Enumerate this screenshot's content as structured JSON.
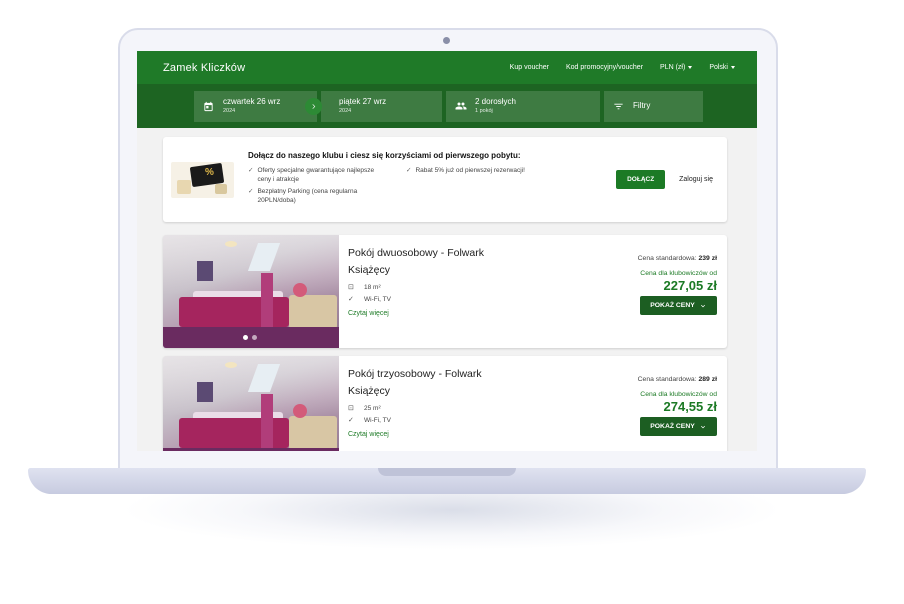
{
  "header": {
    "brand": "Zamek Kliczków",
    "links": {
      "voucher": "Kup voucher",
      "promo": "Kod promocyjny/voucher",
      "currency": "PLN (zł)",
      "language": "Polski"
    }
  },
  "search": {
    "checkin": {
      "day": "czwartek 26 wrz",
      "year": "2024"
    },
    "checkout": {
      "day": "piątek 27 wrz",
      "year": "2024"
    },
    "guests": {
      "main": "2 dorosłych",
      "sub": "1 pokój"
    },
    "filters": "Filtry"
  },
  "club": {
    "title": "Dołącz do naszego klubu i ciesz się korzyściami od pierwszego pobytu:",
    "perks_left": [
      "Oferty specjalne gwarantujące najlepsze ceny i atrakcje",
      "Bezpłatny Parking (cena regularna 20PLN/doba)"
    ],
    "perks_right": [
      "Rabat 5% już od pierwszej rezerwacji!"
    ],
    "join_label": "DOŁĄCZ",
    "login_label": "Zaloguj się"
  },
  "rooms": [
    {
      "name": "Pokój dwuosobowy - Folwark Książęcy",
      "area": "18 m²",
      "amenities": "Wi-Fi, TV",
      "read_more": "Czytaj więcej",
      "std_label": "Cena standardowa:",
      "std_price": "239 zł",
      "club_label": "Cena dla klubowiczów od",
      "club_price": "227,05 zł",
      "button": "POKAŻ CENY"
    },
    {
      "name": "Pokój trzyosobowy - Folwark Książęcy",
      "area": "25 m²",
      "amenities": "Wi-Fi, TV",
      "read_more": "Czytaj więcej",
      "std_label": "Cena standardowa:",
      "std_price": "289 zł",
      "club_label": "Cena dla klubowiczów od",
      "club_price": "274,55 zł",
      "button": "POKAŻ CENY"
    }
  ],
  "colors": {
    "primary": "#1f7a28",
    "primary_dark": "#1d6422",
    "accent_text": "#1c7a25"
  }
}
